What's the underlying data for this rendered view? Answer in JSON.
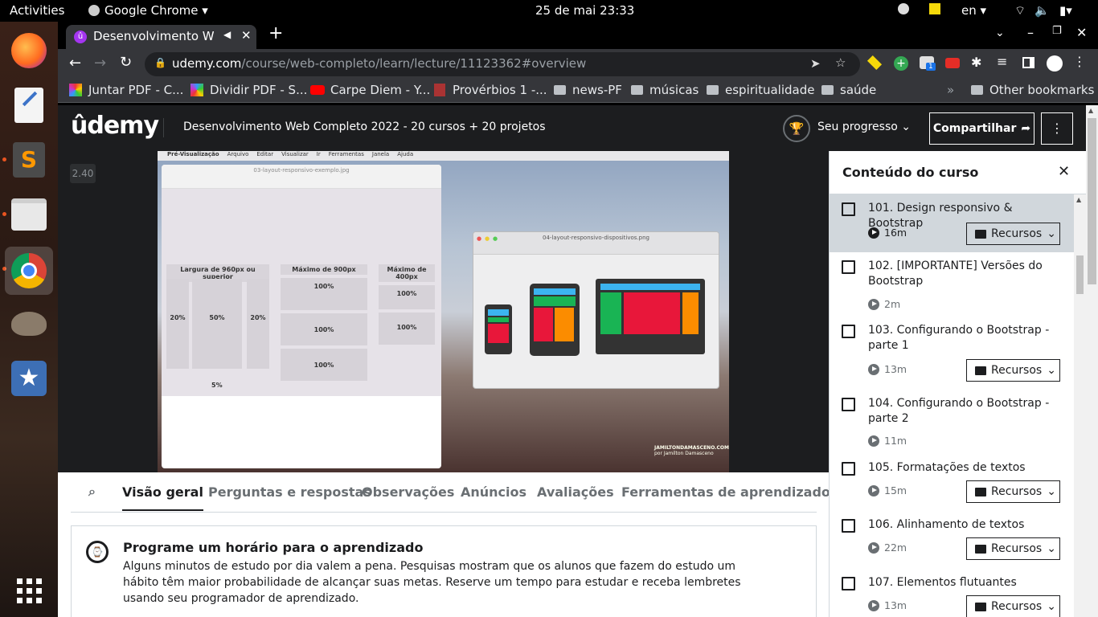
{
  "system": {
    "activities": "Activities",
    "app_name": "Google Chrome",
    "datetime": "25 de mai  23:33",
    "lang": "en"
  },
  "browser": {
    "tab_title": "Desenvolvimento Web",
    "url_domain": "udemy.com",
    "url_path": "/course/web-completo/learn/lecture/11123362#overview",
    "extension_badge": "1",
    "bookmarks": [
      "Juntar PDF - C...",
      "Dividir PDF - S...",
      "Carpe Diem - Y...",
      "Provérbios 1 -...",
      "news-PF",
      "músicas",
      "espiritualidade",
      "saúde"
    ],
    "other_bookmarks": "Other bookmarks"
  },
  "udemy": {
    "logo": "ûdemy",
    "course_title": "Desenvolvimento Web Completo 2022 - 20 cursos + 20 projetos",
    "progress_label": "Seu progresso",
    "share_label": "Compartilhar",
    "speed": "2.40"
  },
  "video": {
    "menu": [
      "Pré-Visualização",
      "Arquivo",
      "Editar",
      "Visualizar",
      "Ir",
      "Ferramentas",
      "Janela",
      "Ajuda"
    ],
    "doc_title": "03-layout-responsivo-exemplo.jpg",
    "col1": "Largura de 960px ou superior",
    "col2": "Máximo de 900px",
    "col3": "Máximo de 400px",
    "p20": "20%",
    "p50": "50%",
    "p100": "100%",
    "p5": "5%",
    "img2_title": "04-layout-responsivo-dispositivos.png",
    "watermark": "JAMILTONDAMASCENO.COM",
    "watermark_sub": "por Jamilton Damasceno"
  },
  "tabs": [
    "Visão geral",
    "Perguntas e respostas",
    "Observações",
    "Anúncios",
    "Avaliações",
    "Ferramentas de aprendizado"
  ],
  "reminder": {
    "title": "Programe um horário para o aprendizado",
    "body": "Alguns minutos de estudo por dia valem a pena. Pesquisas mostram que os alunos que fazem do estudo um hábito têm maior probabilidade de alcançar suas metas. Reserve um tempo para estudar e receba lembretes usando seu programador de aprendizado."
  },
  "sidebar": {
    "title": "Conteúdo do curso",
    "resources_label": "Recursos",
    "lectures": [
      {
        "title": "101. Design responsivo & Bootstrap",
        "duration": "16m"
      },
      {
        "title": "102. [IMPORTANTE] Versões do Bootstrap",
        "duration": "2m"
      },
      {
        "title": "103. Configurando o Bootstrap - parte 1",
        "duration": "13m"
      },
      {
        "title": "104. Configurando o Bootstrap - parte 2",
        "duration": "11m"
      },
      {
        "title": "105. Formatações de textos",
        "duration": "15m"
      },
      {
        "title": "106. Alinhamento de textos",
        "duration": "22m"
      },
      {
        "title": "107. Elementos flutuantes",
        "duration": "13m"
      }
    ]
  }
}
